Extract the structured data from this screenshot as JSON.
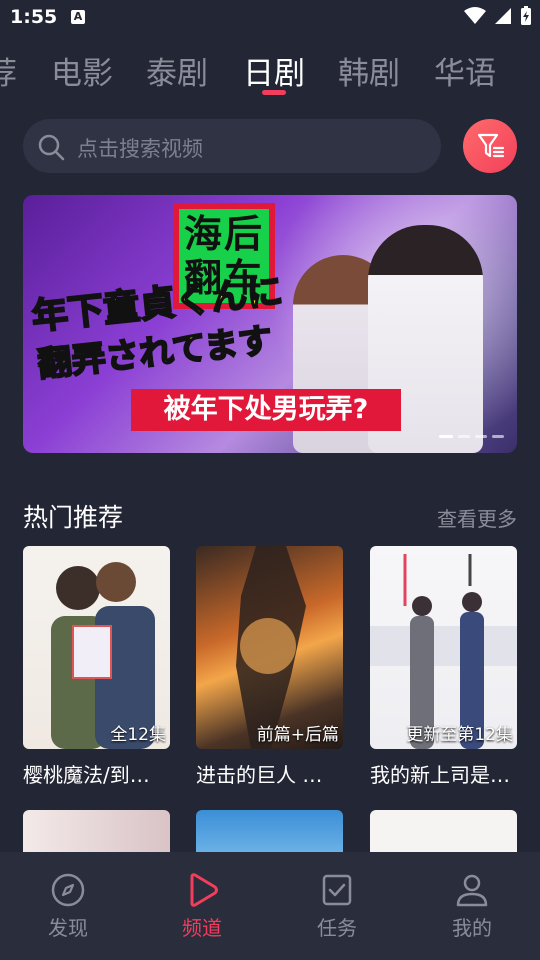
{
  "status": {
    "time": "1:55",
    "notif": "A"
  },
  "tabs": [
    {
      "label": "荐"
    },
    {
      "label": "电影"
    },
    {
      "label": "泰剧"
    },
    {
      "label": "日剧",
      "active": true
    },
    {
      "label": "韩剧"
    },
    {
      "label": "华语"
    }
  ],
  "search": {
    "placeholder": "点击搜索视频"
  },
  "banner": {
    "title_line1": "海后",
    "title_line2": "翻车",
    "jp_line1": "年下童貞くんに",
    "jp_line2": "翻弄されてます",
    "subtitle": "被年下处男玩弄?"
  },
  "section": {
    "title": "热门推荐",
    "more": "查看更多"
  },
  "cards": [
    {
      "title": "樱桃魔法/到…",
      "badge": "全12集"
    },
    {
      "title": "进击的巨人 …",
      "badge": "前篇+后篇"
    },
    {
      "title": "我的新上司是…",
      "badge": "更新至第12集"
    }
  ],
  "nav": [
    {
      "label": "发现",
      "icon": "compass-icon"
    },
    {
      "label": "频道",
      "icon": "play-icon",
      "active": true
    },
    {
      "label": "任务",
      "icon": "task-icon"
    },
    {
      "label": "我的",
      "icon": "user-icon"
    }
  ],
  "colors": {
    "accent": "#f23d5c",
    "background": "#232634",
    "inactive": "#8a8d99"
  }
}
